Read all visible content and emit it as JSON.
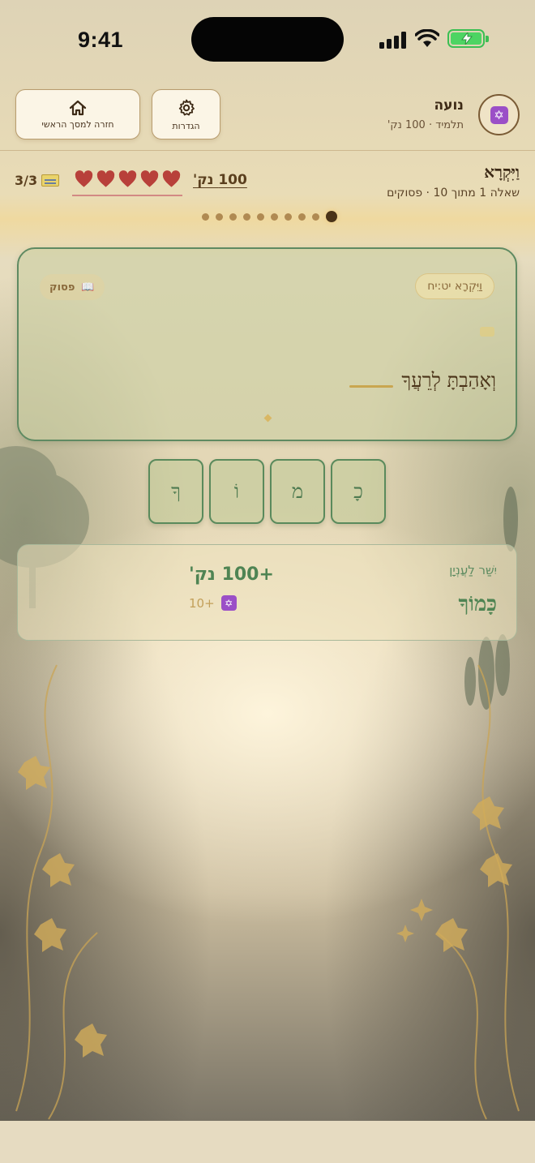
{
  "status_bar": {
    "time": "9:41"
  },
  "header": {
    "home_label": "חזרה למסך הראשי",
    "settings_label": "הגדרות",
    "user_name": "נועה",
    "user_sub": "תלמיד · 100 נק'",
    "avatar_icon": "star-of-david-icon"
  },
  "info": {
    "book": "וַיִּקְרָא",
    "progress": "שאלה 1 מתוך 10 · פסוקים",
    "points": "100 נק'",
    "hearts": 5,
    "tickets": "3/3"
  },
  "dots": {
    "total": 10,
    "current": 1
  },
  "verse_card": {
    "reference": "וַיִּקְרָא יט:יח",
    "type_label": "פסוק",
    "type_icon": "📖",
    "verse_text": "וְאָהַבְתָּ לְרֵעֲךָ"
  },
  "letters": [
    "כָ",
    "מ",
    "וֹ",
    "ךָ"
  ],
  "result": {
    "label": "יִשַּׁר לַעֲנְיָן",
    "answer": "כָּמוֹךָ",
    "points": "+100 נק'",
    "bonus": "+10",
    "bonus_icon": "star-of-david-icon"
  },
  "colors": {
    "accent_green": "#4f8453",
    "heart_red": "#b8403a",
    "brown_text": "#4a3318",
    "gold": "#c9a650"
  }
}
